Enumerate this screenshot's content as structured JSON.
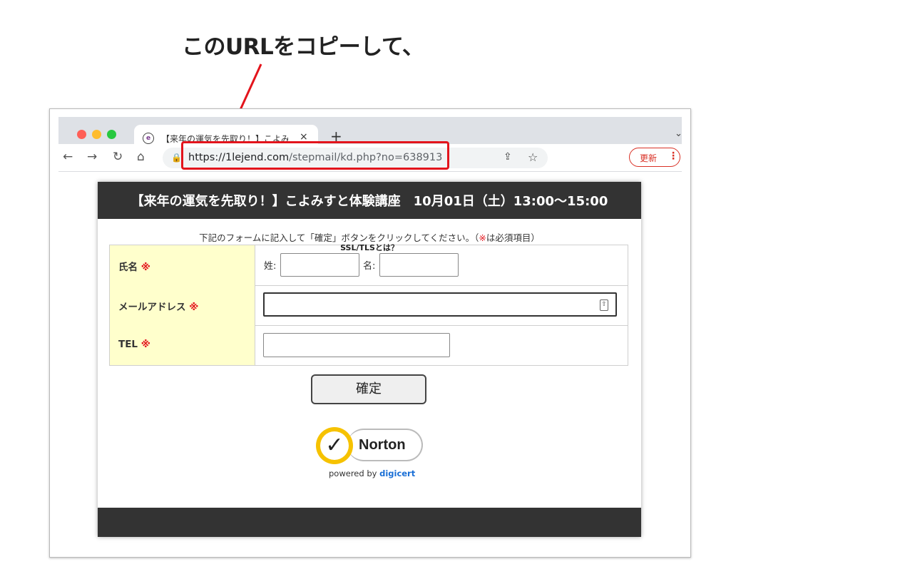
{
  "annotation": {
    "text": "このURLをコピーして、"
  },
  "browser": {
    "tab": {
      "title": "【来年の運気を先取り！】こよみすと体験講座",
      "favicon": "e",
      "close_icon": "×"
    },
    "new_tab_icon": "+",
    "tab_menu_icon": "⌄",
    "nav": {
      "back_icon": "←",
      "forward_icon": "→",
      "reload_icon": "↻",
      "home_icon": "⌂"
    },
    "url": {
      "host": "https://1lejend.com",
      "path": "/stepmail/kd.php?no=638913"
    },
    "lock_icon": "🔒",
    "share_icon": "⇪",
    "star_icon": "☆",
    "update_button": {
      "label": "更新",
      "menu_icon": "⋮"
    },
    "highlight_color": "#e3141c"
  },
  "page": {
    "header_title": "【来年の運気を先取り！】こよみすと体験講座　10月01日（土）13:00〜15:00",
    "instruction_main": "下記のフォームに記入して「確定」ボタンをクリックしてください。（",
    "instruction_mark": "※",
    "instruction_tail": "は必須項目）",
    "form": {
      "name_label": "氏名",
      "email_label": "メールアドレス",
      "tel_label": "TEL",
      "required_mark": "※",
      "last_name_label": "姓:",
      "first_name_label": "名:",
      "last_name_value": "",
      "first_name_value": "",
      "email_value": "",
      "tel_value": "",
      "key_icon": "⇧"
    },
    "confirm_button": "確定",
    "norton": {
      "name": "Norton",
      "powered_by": "powered by",
      "brand": "digicert",
      "check_icon": "✓"
    },
    "ssl_link": "SSL/TLSとは？"
  }
}
